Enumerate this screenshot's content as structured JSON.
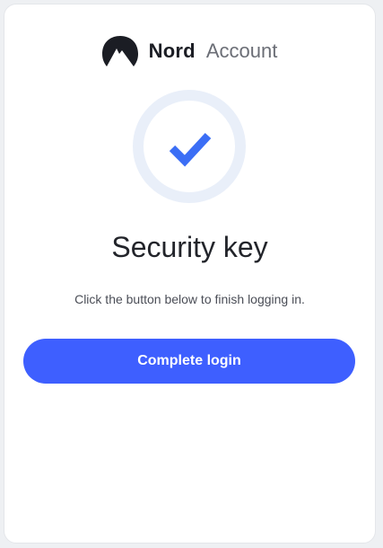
{
  "brand": {
    "name": "Nord",
    "product": "Account",
    "logo_icon": "mountain-logo-icon"
  },
  "status_icon": "checkmark-icon",
  "title": "Security key",
  "subtitle": "Click the button below to finish logging in.",
  "primary_button": {
    "label": "Complete login"
  },
  "colors": {
    "accent": "#3e5fff",
    "check": "#3b6ef5",
    "ring": "#e9eff9",
    "heading": "#22242a"
  }
}
